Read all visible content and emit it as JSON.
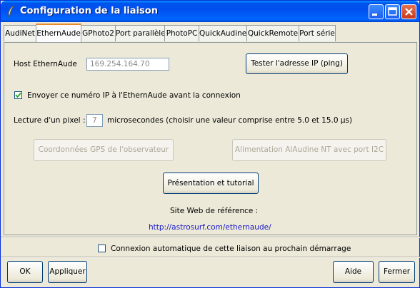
{
  "window": {
    "title": "Configuration de la liaison"
  },
  "tabs": [
    {
      "label": "AudiNet"
    },
    {
      "label": "EthernAude",
      "active": true
    },
    {
      "label": "GPhoto2"
    },
    {
      "label": "Port parallèle"
    },
    {
      "label": "PhotoPC"
    },
    {
      "label": "QuickAudine"
    },
    {
      "label": "QuickRemote"
    },
    {
      "label": "Port série"
    }
  ],
  "ethernaude": {
    "host_label": "Host EthernAude",
    "host_value": "169.254.164.70",
    "ping_button": "Tester l'adresse IP (ping)",
    "send_ip_checkbox": "Envoyer ce numéro IP à l'EthernAude avant la connexion",
    "send_ip_checked": true,
    "pixel_label": "Lecture d'un pixel :",
    "pixel_value": "7",
    "pixel_hint": "microsecondes (choisir une valeur comprise entre 5.0 et 15.0 µs)",
    "gps_button": "Coordonnées GPS de l'observateur",
    "power_button": "Alimentation AlAudine NT avec port I2C",
    "tutorial_button": "Présentation et tutorial",
    "website_label": "Site Web de référence :",
    "website_link": "http://astrosurf.com/ethernaude/"
  },
  "footer": {
    "auto_connect_label": "Connexion automatique de cette liaison au prochain démarrage",
    "auto_connect_checked": false,
    "ok": "OK",
    "apply": "Appliquer",
    "help": "Aide",
    "close": "Fermer"
  },
  "colors": {
    "titlebar": "#0054e3",
    "link": "#1818c8",
    "active_tab_accent": "#e68b2c"
  }
}
